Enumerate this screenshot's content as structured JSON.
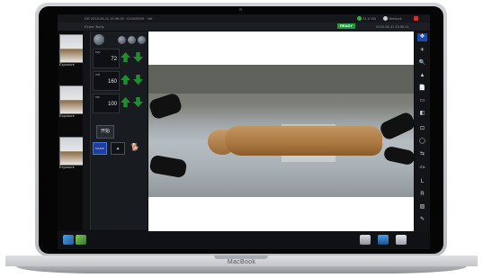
{
  "brand": "MacBook",
  "status_bar": {
    "line1": "DR  2019-06-11 15:56:26 · DX000009 · Vet",
    "line2": "Exam: Body",
    "ready": "READY",
    "temp": "31.5 GB",
    "network": "Network",
    "datetime": "2019-06-11 15:56:41"
  },
  "thumbnails": [
    {
      "label": "Exposure"
    },
    {
      "label": "Exposure"
    },
    {
      "label": "Exposure"
    }
  ],
  "exposure": {
    "kvp_label": "kvp",
    "kvp": "72",
    "ma_label": "mA",
    "ma": "160",
    "ms_label": "ms",
    "ms": "100"
  },
  "start_label": "开始",
  "modes": [
    {
      "label": "MA/MS"
    },
    {
      "label": "▣"
    },
    {
      "label": "🐕"
    }
  ],
  "tools": [
    "✥",
    "☀",
    "🔍",
    "▲",
    "📄",
    "▭",
    "◧",
    "⊡",
    "◯",
    "⇆",
    "ITA",
    "L",
    "R",
    "▧",
    "✎"
  ],
  "colors": {
    "ready_green": "#1f9b3a",
    "arrow_green": "#1e8f2e",
    "highlight_blue": "#1d4aa8"
  }
}
